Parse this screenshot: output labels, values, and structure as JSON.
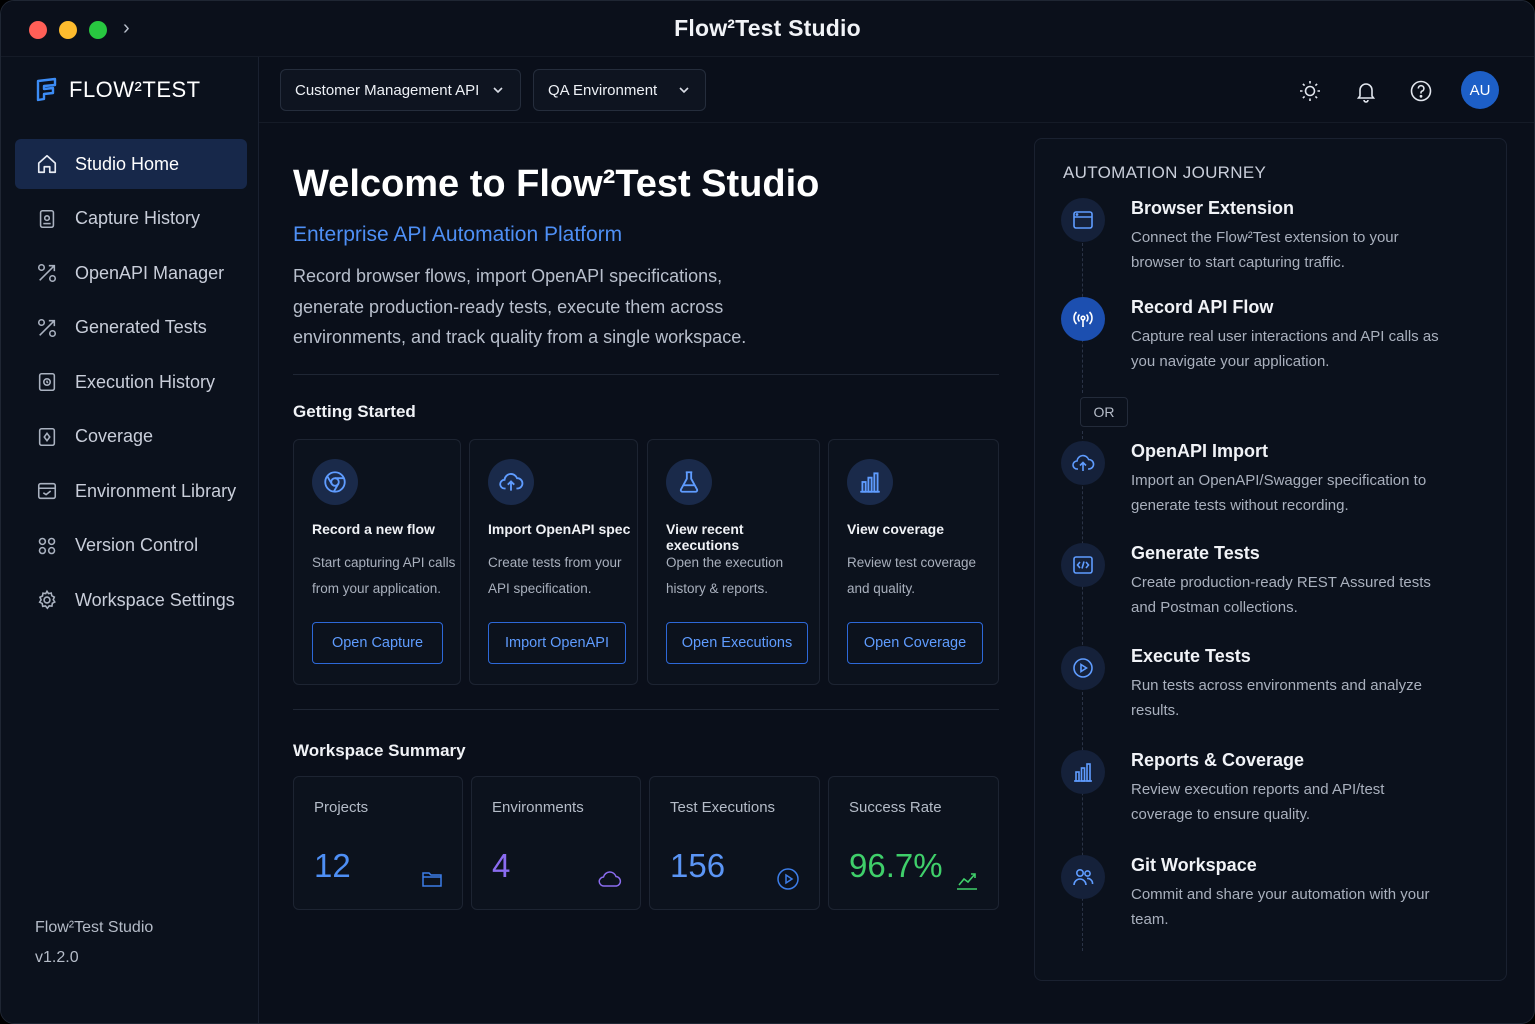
{
  "window": {
    "title": "Flow²Test Studio"
  },
  "sidebar": {
    "logo_text": "FLOW²TEST",
    "items": [
      {
        "label": "Studio Home",
        "icon": "home-icon",
        "active": true
      },
      {
        "label": "Capture History",
        "icon": "capture-icon"
      },
      {
        "label": "OpenAPI Manager",
        "icon": "api-icon"
      },
      {
        "label": "Generated Tests",
        "icon": "tests-icon"
      },
      {
        "label": "Execution History",
        "icon": "history-icon"
      },
      {
        "label": "Coverage",
        "icon": "coverage-icon"
      },
      {
        "label": "Environment Library",
        "icon": "environment-icon"
      },
      {
        "label": "Version Control",
        "icon": "version-icon"
      },
      {
        "label": "Workspace Settings",
        "icon": "gear-icon"
      }
    ],
    "footer_name": "Flow²Test Studio",
    "footer_version": "v1.2.0"
  },
  "topbar": {
    "project_select": "Customer Management API",
    "environment_select": "QA Environment",
    "avatar_initials": "AU"
  },
  "main": {
    "welcome_title": "Welcome to Flow²Test Studio",
    "subtitle": "Enterprise API Automation Platform",
    "description": "Record browser flows, import OpenAPI specifications, generate production-ready tests, execute them across environments, and track quality from a single workspace.",
    "getting_started_title": "Getting Started",
    "cards": [
      {
        "title": "Record a new flow",
        "desc": "Start capturing API calls from your application.",
        "button": "Open Capture",
        "icon": "chrome-icon"
      },
      {
        "title": "Import OpenAPI spec",
        "desc": "Create tests from your API specification.",
        "button": "Import OpenAPI",
        "icon": "cloud-upload-icon"
      },
      {
        "title": "View recent executions",
        "desc": "Open the execution history & reports.",
        "button": "Open Executions",
        "icon": "flask-icon"
      },
      {
        "title": "View coverage",
        "desc": "Review test coverage and quality.",
        "button": "Open Coverage",
        "icon": "bar-chart-icon"
      }
    ],
    "summary_title": "Workspace Summary",
    "stats": [
      {
        "label": "Projects",
        "value": "12",
        "color": "#4e8ff5",
        "icon": "folder-icon"
      },
      {
        "label": "Environments",
        "value": "4",
        "color": "#8b6cf0",
        "icon": "cloud-icon"
      },
      {
        "label": "Test Executions",
        "value": "156",
        "color": "#5b95f5",
        "icon": "play-circle-icon"
      },
      {
        "label": "Success Rate",
        "value": "96.7%",
        "color": "#3fcf6a",
        "icon": "trend-up-icon"
      }
    ]
  },
  "journey": {
    "title": "AUTOMATION JOURNEY",
    "or_label": "OR",
    "steps": [
      {
        "title": "Browser Extension",
        "desc": "Connect the Flow²Test extension to your browser to start capturing traffic.",
        "icon": "browser-icon"
      },
      {
        "title": "Record API Flow",
        "desc": "Capture real user interactions and API calls as you navigate your application.",
        "icon": "broadcast-icon"
      },
      {
        "title": "OpenAPI Import",
        "desc": "Import an OpenAPI/Swagger specification to generate tests without recording.",
        "icon": "cloud-upload-icon"
      },
      {
        "title": "Generate Tests",
        "desc": "Create production-ready REST Assured tests and Postman collections.",
        "icon": "code-icon"
      },
      {
        "title": "Execute Tests",
        "desc": "Run tests across environments and analyze results.",
        "icon": "play-circle-icon"
      },
      {
        "title": "Reports & Coverage",
        "desc": "Review execution reports and API/test coverage to ensure quality.",
        "icon": "bar-chart-icon"
      },
      {
        "title": "Git Workspace",
        "desc": "Commit and share your automation with your team.",
        "icon": "users-icon"
      }
    ]
  },
  "colors": {
    "accent": "#4e8ff5",
    "background": "#0a0f1a",
    "success": "#3fcf6a"
  }
}
